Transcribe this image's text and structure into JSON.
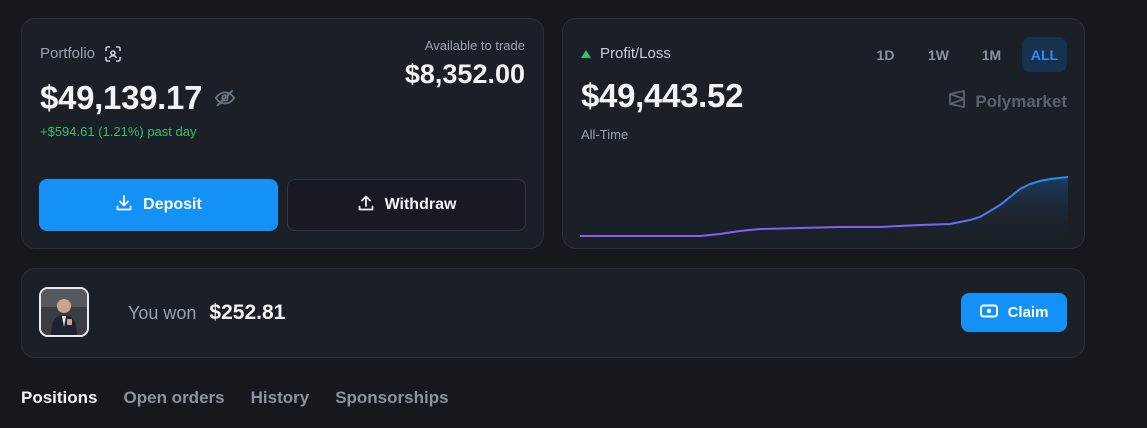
{
  "portfolio": {
    "label": "Portfolio",
    "value": "$49,139.17",
    "change": "+$594.61 (1.21%) past day",
    "available_label": "Available to trade",
    "available_value": "$8,352.00",
    "deposit_label": "Deposit",
    "withdraw_label": "Withdraw"
  },
  "pnl": {
    "label": "Profit/Loss",
    "value": "$49,443.52",
    "period": "All-Time",
    "brand": "Polymarket",
    "ranges": [
      "1D",
      "1W",
      "1M",
      "ALL"
    ],
    "active_range": "ALL"
  },
  "won": {
    "prefix": "You won",
    "amount": "$252.81",
    "claim_label": "Claim"
  },
  "tabs": [
    "Positions",
    "Open orders",
    "History",
    "Sponsorships"
  ],
  "active_tab": "Positions",
  "colors": {
    "accent": "#1491f7",
    "positive": "#3fb96a",
    "line_start": "#8a5cf0",
    "line_end": "#1e8ff0"
  }
}
